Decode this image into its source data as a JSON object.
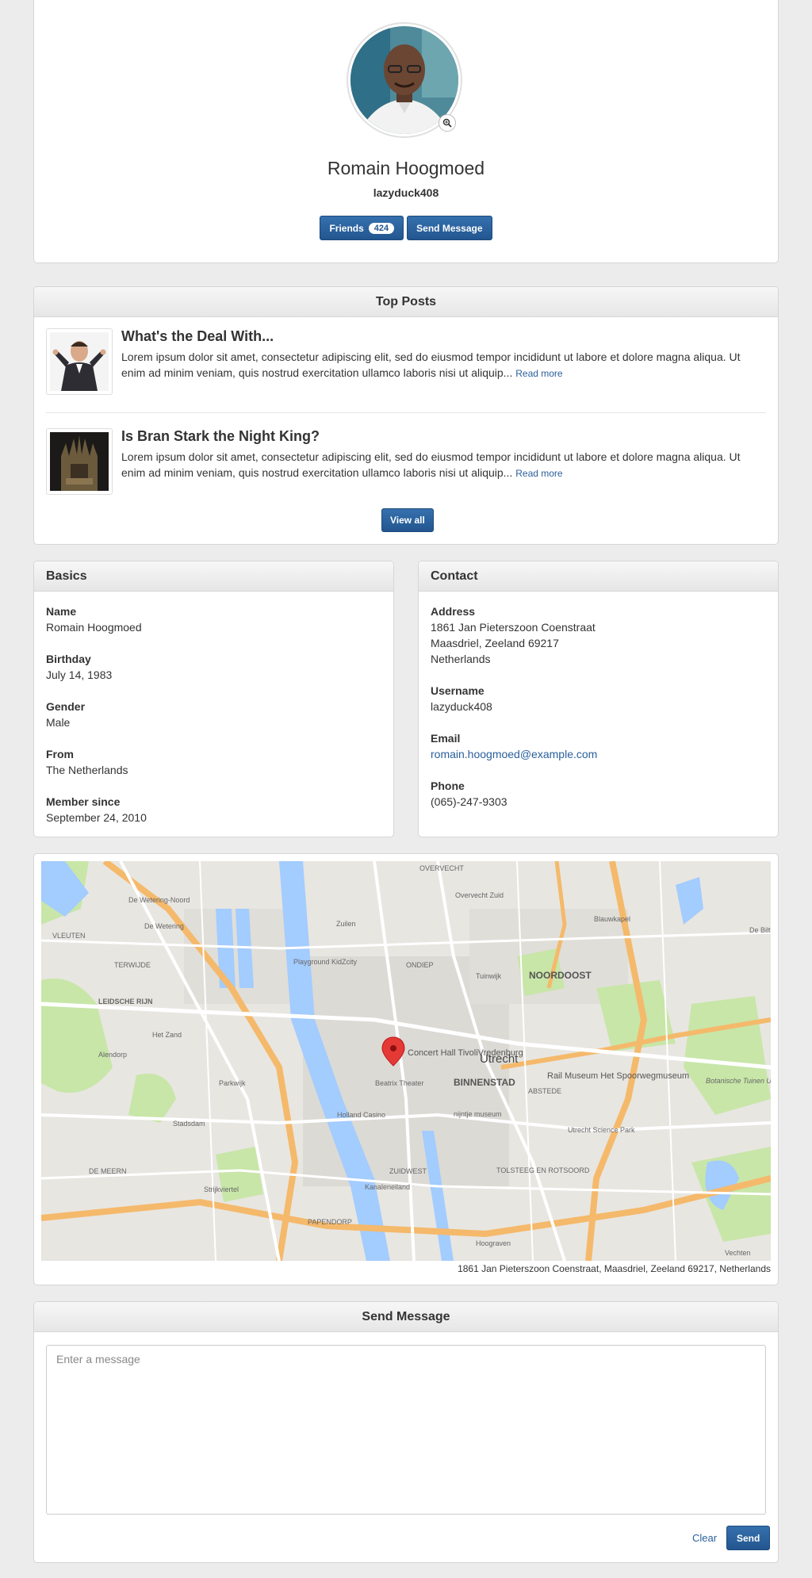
{
  "profile": {
    "name": "Romain Hoogmoed",
    "username": "lazyduck408",
    "friends_label": "Friends",
    "friends_count": "424",
    "send_message_label": "Send Message"
  },
  "top_posts": {
    "title": "Top Posts",
    "posts": [
      {
        "title": "What's the Deal With...",
        "body": "Lorem ipsum dolor sit amet, consectetur adipiscing elit, sed do eiusmod tempor incididunt ut labore et dolore magna aliqua. Ut enim ad minim veniam, quis nostrud exercitation ullamco laboris nisi ut aliquip...",
        "read_more": "Read more"
      },
      {
        "title": "Is Bran Stark the Night King?",
        "body": "Lorem ipsum dolor sit amet, consectetur adipiscing elit, sed do eiusmod tempor incididunt ut labore et dolore magna aliqua. Ut enim ad minim veniam, quis nostrud exercitation ullamco laboris nisi ut aliquip...",
        "read_more": "Read more"
      }
    ],
    "view_all_label": "View all"
  },
  "basics": {
    "title": "Basics",
    "fields": [
      {
        "label": "Name",
        "value": "Romain Hoogmoed"
      },
      {
        "label": "Birthday",
        "value": "July 14, 1983"
      },
      {
        "label": "Gender",
        "value": "Male"
      },
      {
        "label": "From",
        "value": "The Netherlands"
      },
      {
        "label": "Member since",
        "value": "September 24, 2010"
      }
    ]
  },
  "contact": {
    "title": "Contact",
    "address_label": "Address",
    "address_line1": "1861 Jan Pieterszoon Coenstraat",
    "address_line2": "Maasdriel, Zeeland 69217",
    "address_line3": "Netherlands",
    "username_label": "Username",
    "username": "lazyduck408",
    "email_label": "Email",
    "email": "romain.hoogmoed@example.com",
    "phone_label": "Phone",
    "phone": "(065)-247-9303"
  },
  "map": {
    "caption": "1861 Jan Pieterszoon Coenstraat, Maasdriel, Zeeland 69217, Netherlands",
    "labels": {
      "overvecht": "OVERVECHT",
      "overvecht_zuid": "Overvecht Zuid",
      "blauwkapel": "Blauwkapel",
      "de_wetering_noord": "De Wetering-Noord",
      "de_wetering": "De Wetering",
      "vleuten": "VLEUTEN",
      "terwijde": "TERWIJDE",
      "zuilen": "Zuilen",
      "ondiep": "ONDIEP",
      "tuinwijk": "Tuinwijk",
      "noordoost": "NOORDOOST",
      "playground": "Playground KidZcity",
      "leidsche_rijn": "LEIDSCHE RIJN",
      "het_zand": "Het Zand",
      "alendorp": "Alendorp",
      "concert_hall": "Concert Hall TivoliVredenburg",
      "utrecht": "Utrecht",
      "binnenstad": "BINNENSTAD",
      "rail_museum": "Rail Museum Het Spoorwegmuseum",
      "parkwijk": "Parkwijk",
      "beatrix": "Beatrix Theater",
      "abstede": "ABSTEDE",
      "botanische": "Botanische Tuinen Utrecht",
      "holland_casino": "Holland Casino",
      "nijntje": "nijntje museum",
      "science_park": "Utrecht Science Park",
      "stadsdam": "Stadsdam",
      "zuidwest": "ZUIDWEST",
      "tolsteeg": "TOLSTEEG EN ROTSOORD",
      "de_meern": "DE MEERN",
      "strijkviertel": "Strijkviertel",
      "kanaleneiland": "Kanaleneiland",
      "papendorp": "PAPENDORP",
      "hoograven": "Hoograven",
      "vechten": "Vechten",
      "de_bilt": "De Bilt"
    }
  },
  "send_message": {
    "title": "Send Message",
    "placeholder": "Enter a message",
    "clear_label": "Clear",
    "send_label": "Send"
  },
  "colors": {
    "primary": "#23568f",
    "link": "#2a5f9b",
    "map_water": "#a3ccff",
    "map_park": "#c8e6a8",
    "map_highway": "#f5b96b",
    "map_pin": "#e53935"
  }
}
